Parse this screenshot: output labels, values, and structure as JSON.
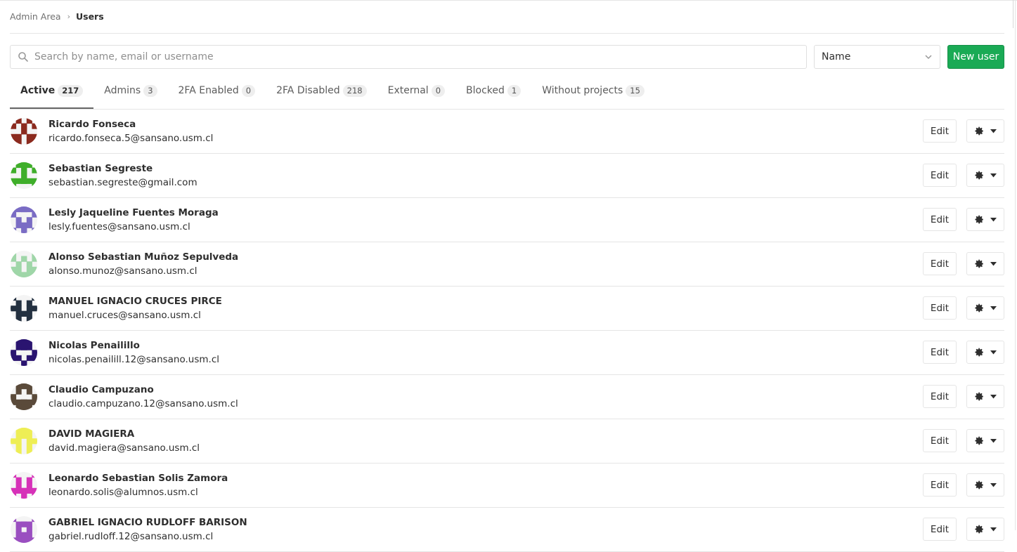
{
  "breadcrumb": {
    "parent": "Admin Area",
    "current": "Users"
  },
  "search": {
    "placeholder": "Search by name, email or username",
    "value": ""
  },
  "sort": {
    "selected": "Name"
  },
  "actions": {
    "new_user_label": "New user"
  },
  "tabs": [
    {
      "label": "Active",
      "count": "217",
      "active": true
    },
    {
      "label": "Admins",
      "count": "3"
    },
    {
      "label": "2FA Enabled",
      "count": "0"
    },
    {
      "label": "2FA Disabled",
      "count": "218"
    },
    {
      "label": "External",
      "count": "0"
    },
    {
      "label": "Blocked",
      "count": "1"
    },
    {
      "label": "Without projects",
      "count": "15"
    }
  ],
  "row_actions": {
    "edit_label": "Edit"
  },
  "users": [
    {
      "name": "Ricardo Fonseca",
      "email": "ricardo.fonseca.5@sansano.usm.cl",
      "avatar_color": "#8b2a1e"
    },
    {
      "name": "Sebastian Segreste",
      "email": "sebastian.segreste@gmail.com",
      "avatar_color": "#3fae2a"
    },
    {
      "name": "Lesly Jaqueline Fuentes Moraga",
      "email": "lesly.fuentes@sansano.usm.cl",
      "avatar_color": "#7a6cc4"
    },
    {
      "name": "Alonso Sebastian Muñoz Sepulveda",
      "email": "alonso.munoz@sansano.usm.cl",
      "avatar_color": "#9fd6a8"
    },
    {
      "name": "MANUEL IGNACIO CRUCES PIRCE",
      "email": "manuel.cruces@sansano.usm.cl",
      "avatar_color": "#233040"
    },
    {
      "name": "Nicolas Penailillo",
      "email": "nicolas.penailill.12@sansano.usm.cl",
      "avatar_color": "#2a1470"
    },
    {
      "name": "Claudio Campuzano",
      "email": "claudio.campuzano.12@sansano.usm.cl",
      "avatar_color": "#5a4a3a"
    },
    {
      "name": "DAVID MAGIERA",
      "email": "david.magiera@sansano.usm.cl",
      "avatar_color": "#eeee55"
    },
    {
      "name": "Leonardo Sebastian Solis Zamora",
      "email": "leonardo.solis@alumnos.usm.cl",
      "avatar_color": "#d631b8"
    },
    {
      "name": "GABRIEL IGNACIO RUDLOFF BARISON",
      "email": "gabriel.rudloff.12@sansano.usm.cl",
      "avatar_color": "#9a4fc0"
    }
  ]
}
